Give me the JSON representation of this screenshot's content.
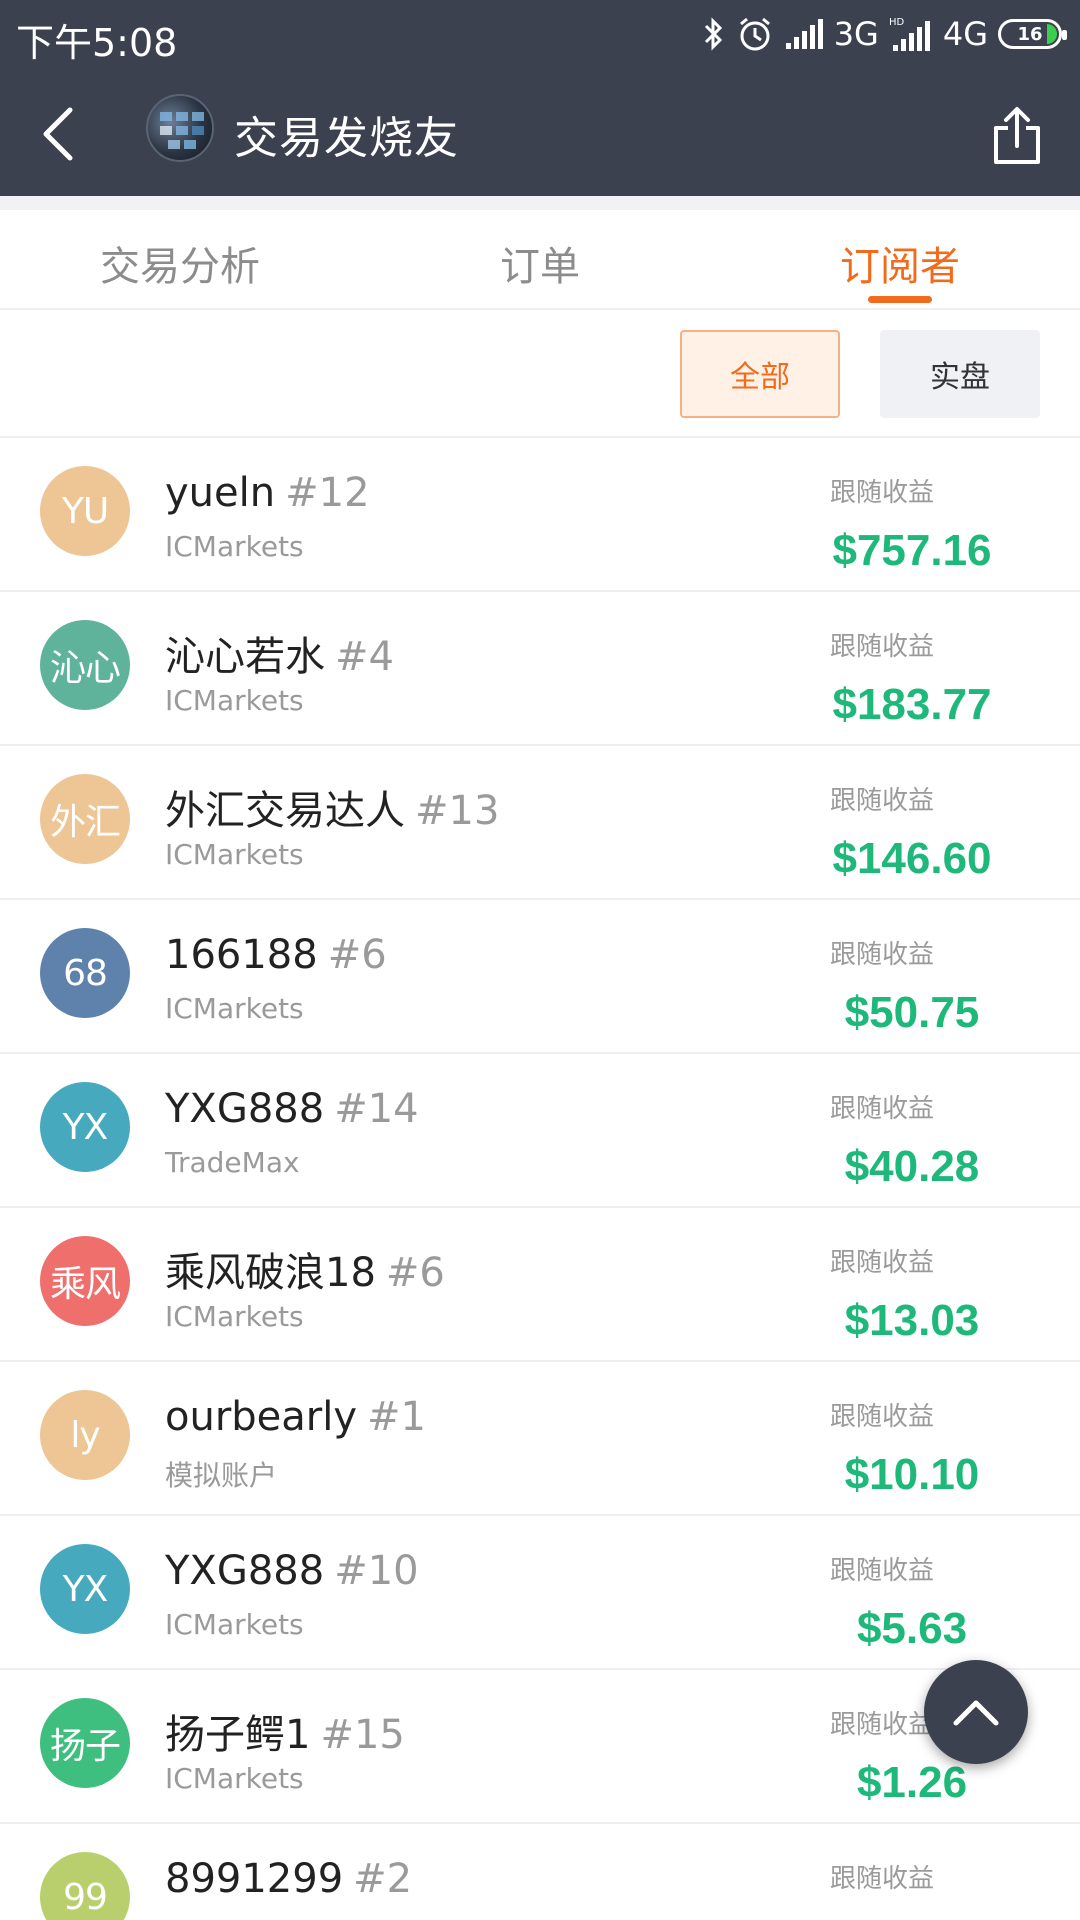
{
  "status_bar": {
    "time": "下午5:08",
    "network_3g": "3G",
    "network_4g": "4G",
    "battery": "16",
    "icons": [
      "bluetooth-icon",
      "alarm-icon",
      "signal-icon",
      "hd-signal-icon"
    ]
  },
  "header": {
    "title": "交易发烧友",
    "back_icon": "chevron-left-icon",
    "share_icon": "share-icon",
    "background_color": "#3b414e"
  },
  "tabs": [
    {
      "label": "交易分析",
      "active": false
    },
    {
      "label": "订单",
      "active": false
    },
    {
      "label": "订阅者",
      "active": true
    }
  ],
  "filters": {
    "all_label": "全部",
    "real_label": "实盘",
    "selected": "全部"
  },
  "colors": {
    "accent": "#f26b1d",
    "income": "#1db87a",
    "header": "#3b414e"
  },
  "subscribers": [
    {
      "avatar_text": "YU",
      "avatar_color": "#eec594",
      "name": "yueln",
      "rank": "#12",
      "broker": "ICMarkets",
      "income_label": "跟随收益",
      "income": "$757.16"
    },
    {
      "avatar_text": "沁心",
      "avatar_color": "#5fb39b",
      "name": "沁心若水",
      "rank": "#4",
      "broker": "ICMarkets",
      "income_label": "跟随收益",
      "income": "$183.77"
    },
    {
      "avatar_text": "外汇",
      "avatar_color": "#eec594",
      "name": "外汇交易达人",
      "rank": "#13",
      "broker": "ICMarkets",
      "income_label": "跟随收益",
      "income": "$146.60"
    },
    {
      "avatar_text": "68",
      "avatar_color": "#5f82ad",
      "name": "166188",
      "rank": "#6",
      "broker": "ICMarkets",
      "income_label": "跟随收益",
      "income": "$50.75"
    },
    {
      "avatar_text": "YX",
      "avatar_color": "#47a9bd",
      "name": "YXG888",
      "rank": "#14",
      "broker": "TradeMax",
      "income_label": "跟随收益",
      "income": "$40.28"
    },
    {
      "avatar_text": "乘风",
      "avatar_color": "#ef6f6c",
      "name": "乘风破浪18",
      "rank": "#6",
      "broker": "ICMarkets",
      "income_label": "跟随收益",
      "income": "$13.03"
    },
    {
      "avatar_text": "ly",
      "avatar_color": "#eec594",
      "name": "ourbearly",
      "rank": "#1",
      "broker": "模拟账户",
      "income_label": "跟随收益",
      "income": "$10.10"
    },
    {
      "avatar_text": "YX",
      "avatar_color": "#47a9bd",
      "name": "YXG888",
      "rank": "#10",
      "broker": "ICMarkets",
      "income_label": "跟随收益",
      "income": "$5.63"
    },
    {
      "avatar_text": "扬子",
      "avatar_color": "#3fbf7f",
      "name": "扬子鳄1",
      "rank": "#15",
      "broker": "ICMarkets",
      "income_label": "跟随收益",
      "income": "$1.26"
    },
    {
      "avatar_text": "99",
      "avatar_color": "#b9cf6d",
      "name": "8991299",
      "rank": "#2",
      "broker": "",
      "income_label": "跟随收益",
      "income": ""
    }
  ]
}
